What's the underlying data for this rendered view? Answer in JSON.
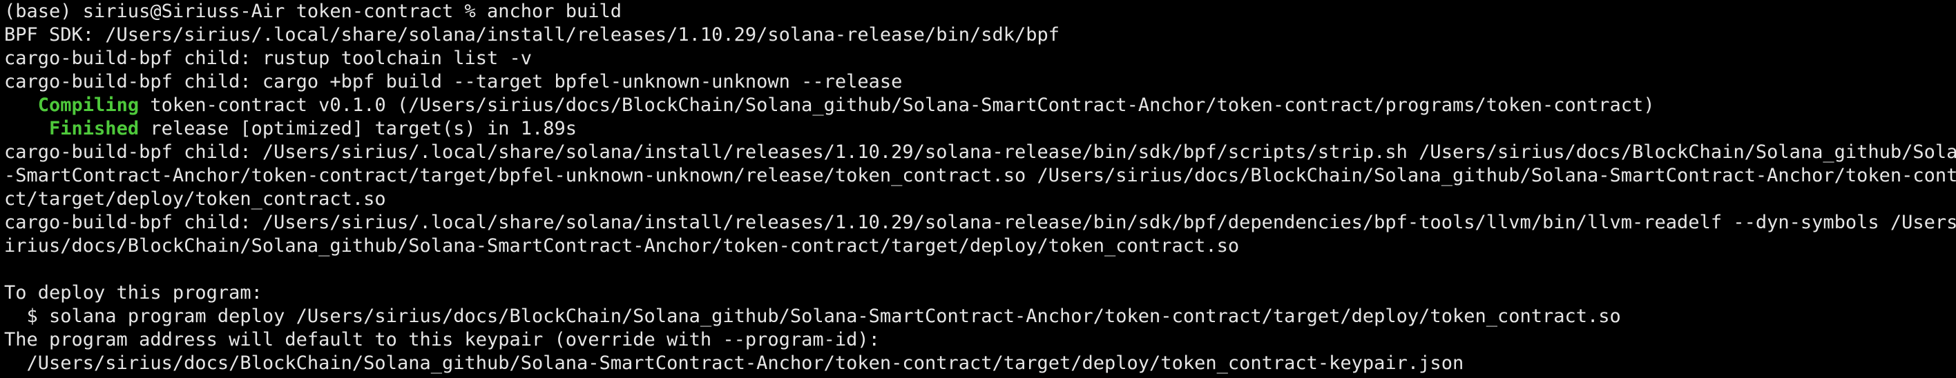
{
  "terminal": {
    "lines": [
      {
        "indent": "",
        "prefix": "",
        "text": "(base) sirius@Siriuss-Air token-contract % anchor build"
      },
      {
        "indent": "",
        "prefix": "",
        "text": "BPF SDK: /Users/sirius/.local/share/solana/install/releases/1.10.29/solana-release/bin/sdk/bpf"
      },
      {
        "indent": "",
        "prefix": "",
        "text": "cargo-build-bpf child: rustup toolchain list -v"
      },
      {
        "indent": "",
        "prefix": "",
        "text": "cargo-build-bpf child: cargo +bpf build --target bpfel-unknown-unknown --release"
      },
      {
        "indent": "   ",
        "prefix": "Compiling",
        "text": " token-contract v0.1.0 (/Users/sirius/docs/BlockChain/Solana_github/Solana-SmartContract-Anchor/token-contract/programs/token-contract)"
      },
      {
        "indent": "    ",
        "prefix": "Finished",
        "text": " release [optimized] target(s) in 1.89s"
      },
      {
        "indent": "",
        "prefix": "",
        "text": "cargo-build-bpf child: /Users/sirius/.local/share/solana/install/releases/1.10.29/solana-release/bin/sdk/bpf/scripts/strip.sh /Users/sirius/docs/BlockChain/Solana_github/Solana"
      },
      {
        "indent": "",
        "prefix": "",
        "text": "-SmartContract-Anchor/token-contract/target/bpfel-unknown-unknown/release/token_contract.so /Users/sirius/docs/BlockChain/Solana_github/Solana-SmartContract-Anchor/token-contra"
      },
      {
        "indent": "",
        "prefix": "",
        "text": "ct/target/deploy/token_contract.so"
      },
      {
        "indent": "",
        "prefix": "",
        "text": "cargo-build-bpf child: /Users/sirius/.local/share/solana/install/releases/1.10.29/solana-release/bin/sdk/bpf/dependencies/bpf-tools/llvm/bin/llvm-readelf --dyn-symbols /Users/s"
      },
      {
        "indent": "",
        "prefix": "",
        "text": "irius/docs/BlockChain/Solana_github/Solana-SmartContract-Anchor/token-contract/target/deploy/token_contract.so"
      },
      {
        "indent": "",
        "prefix": "",
        "text": ""
      },
      {
        "indent": "",
        "prefix": "",
        "text": "To deploy this program:"
      },
      {
        "indent": "  ",
        "prefix": "",
        "text": "$ solana program deploy /Users/sirius/docs/BlockChain/Solana_github/Solana-SmartContract-Anchor/token-contract/target/deploy/token_contract.so"
      },
      {
        "indent": "",
        "prefix": "",
        "text": "The program address will default to this keypair (override with --program-id):"
      },
      {
        "indent": "  ",
        "prefix": "",
        "text": "/Users/sirius/docs/BlockChain/Solana_github/Solana-SmartContract-Anchor/token-contract/target/deploy/token_contract-keypair.json"
      }
    ]
  },
  "colors": {
    "background": "#000000",
    "text": "#e6e6e6",
    "cargo_status_green": "#4ec93b"
  }
}
